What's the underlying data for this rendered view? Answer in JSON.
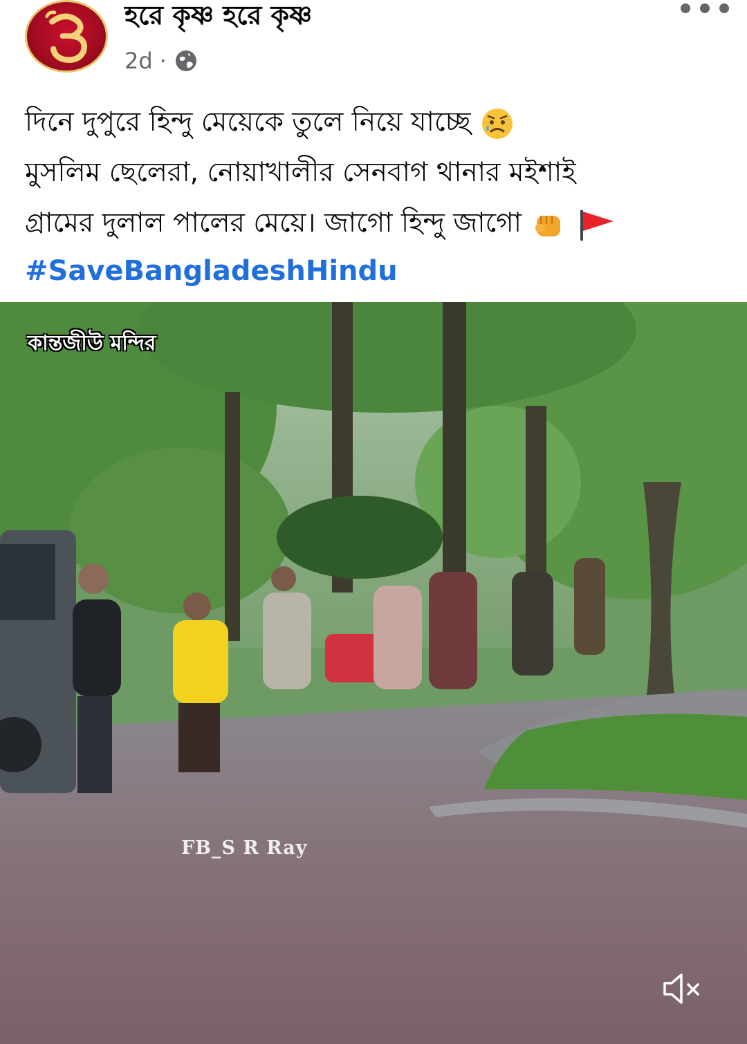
{
  "post": {
    "page_name": "হরে কৃষ্ণ হরে কৃষ্ণ",
    "time": "2d",
    "separator": "·",
    "audience_icon": "globe-icon",
    "more_icon": "more-dots-icon"
  },
  "body": {
    "line1": "দিনে দুপুরে হিন্দু মেয়েকে তুলে নিয়ে যাচ্ছে",
    "line2": "মুসলিম ছেলেরা, নোয়াখালীর সেনবাগ থানার মইশাই",
    "line3": "গ্রামের দুলাল পালের মেয়ে। জাগো হিন্দু জাগো",
    "hashtag": "#SaveBangladeshHindu",
    "emojis": [
      "sad-face-emoji",
      "raised-fist-emoji",
      "red-flag-emoji"
    ]
  },
  "media": {
    "caption": "কান্তজীউ মন্দির",
    "watermark": "FB_S R Ray",
    "mute_icon": "speaker-muted-icon"
  },
  "colors": {
    "hashtag": "#216fdb",
    "secondary_text": "#65676b",
    "avatar_red": "#c8102e"
  }
}
